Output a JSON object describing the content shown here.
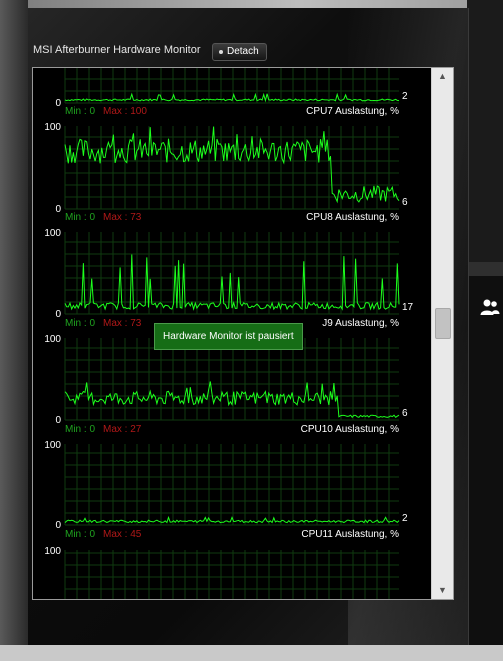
{
  "window": {
    "title": "MSI Afterburner Hardware Monitor",
    "detach_label": "Detach"
  },
  "tooltip": "Hardware Monitor ist pausiert",
  "graphs": [
    {
      "label": "CPU7 Auslastung, %",
      "scale_top": "",
      "scale_bottom": "0",
      "min_text": "Min : 0",
      "max_text": "Max : 100",
      "current": "2"
    },
    {
      "label": "CPU8 Auslastung, %",
      "scale_top": "100",
      "scale_bottom": "0",
      "min_text": "Min : 0",
      "max_text": "Max : 73",
      "current": "6"
    },
    {
      "label": "J9 Auslastung, %",
      "scale_top": "100",
      "scale_bottom": "0",
      "min_text": "Min : 0",
      "max_text": "Max : 73",
      "current": "17"
    },
    {
      "label": "CPU10 Auslastung, %",
      "scale_top": "100",
      "scale_bottom": "0",
      "min_text": "Min : 0",
      "max_text": "Max : 27",
      "current": "6"
    },
    {
      "label": "CPU11 Auslastung, %",
      "scale_top": "100",
      "scale_bottom": "0",
      "min_text": "Min : 0",
      "max_text": "Max : 45",
      "current": "2"
    },
    {
      "label": "",
      "scale_top": "100",
      "scale_bottom": "",
      "min_text": "",
      "max_text": "",
      "current": ""
    }
  ],
  "colors": {
    "line": "#1cff1c",
    "grid": "#0f3a0f",
    "min_text": "#1fa31f",
    "max_text": "#b01818",
    "label": "#ffffff",
    "tooltip_bg": "#166d16"
  },
  "icons": {
    "detach": "dot-icon",
    "users": "users-icon",
    "scroll_up": "chevron-up-icon",
    "scroll_down": "chevron-down-icon"
  }
}
